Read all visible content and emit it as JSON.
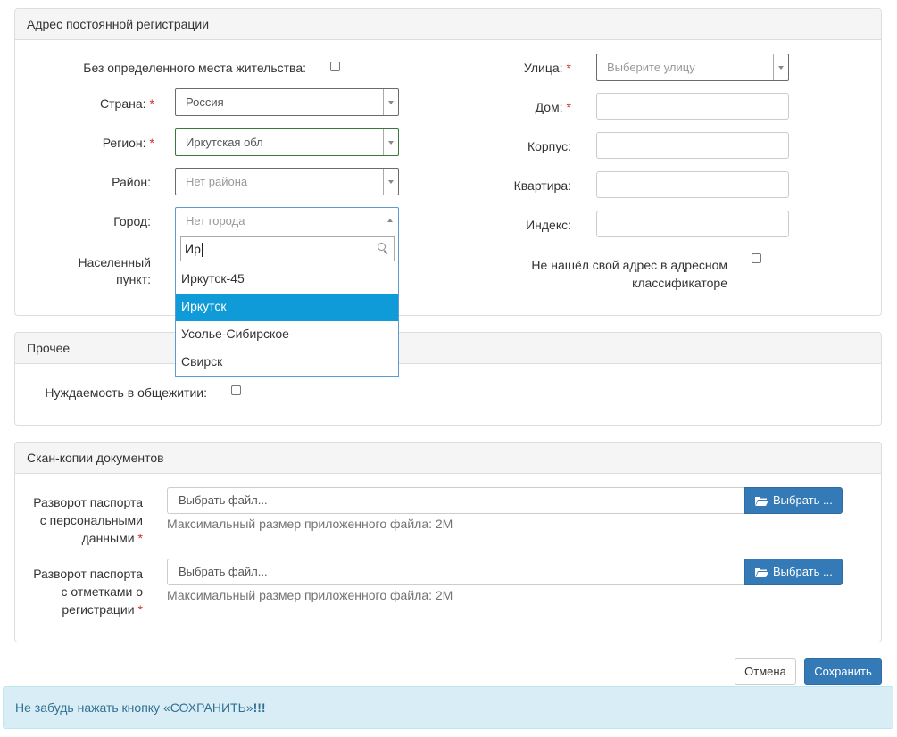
{
  "address": {
    "title": "Адрес постоянной регистрации",
    "no_residence_label": "Без определенного места жительства:",
    "country": {
      "label": "Страна:",
      "value": "Россия"
    },
    "region": {
      "label": "Регион:",
      "value": "Иркутская обл"
    },
    "district": {
      "label": "Район:",
      "value": "Нет района"
    },
    "city": {
      "label": "Город:",
      "value": "Нет города",
      "search_text": "Ир",
      "options": [
        "Иркутск-45",
        "Иркутск",
        "Усолье-Сибирское",
        "Свирск"
      ],
      "highlighted": "Иркутск"
    },
    "locality_label_line1": "Населенный",
    "locality_label_line2": "пункт:",
    "street": {
      "label": "Улица:",
      "placeholder": "Выберите улицу"
    },
    "house_label": "Дом:",
    "building_label": "Корпус:",
    "apartment_label": "Квартира:",
    "postcode_label": "Индекс:",
    "not_found_line1": "Не нашёл свой адрес в адресном",
    "not_found_line2": "классификаторе",
    "required_mark": "*"
  },
  "other": {
    "title": "Прочее",
    "dormitory_label": "Нуждаемость в общежитии:"
  },
  "scans": {
    "title": "Скан-копии документов",
    "passport_personal_label_l1": "Разворот паспорта",
    "passport_personal_label_l2": "с персональными",
    "passport_personal_label_l3": "данными",
    "passport_reg_label_l1": "Разворот паспорта",
    "passport_reg_label_l2": "с отметками о",
    "passport_reg_label_l3": "регистрации",
    "file_placeholder": "Выбрать файл...",
    "choose_button": "Выбрать ...",
    "max_size_hint": "Максимальный размер приложенного файла: 2M"
  },
  "actions": {
    "cancel": "Отмена",
    "save": "Сохранить"
  },
  "alert": {
    "text": "Не забудь нажать кнопку «СОХРАНИТЬ»",
    "emphasis": "!!!"
  },
  "colors": {
    "primary": "#337ab7",
    "highlight": "#0f9ad8",
    "required": "#c9302c",
    "alert_bg": "#d9edf7",
    "alert_text": "#31708f"
  }
}
